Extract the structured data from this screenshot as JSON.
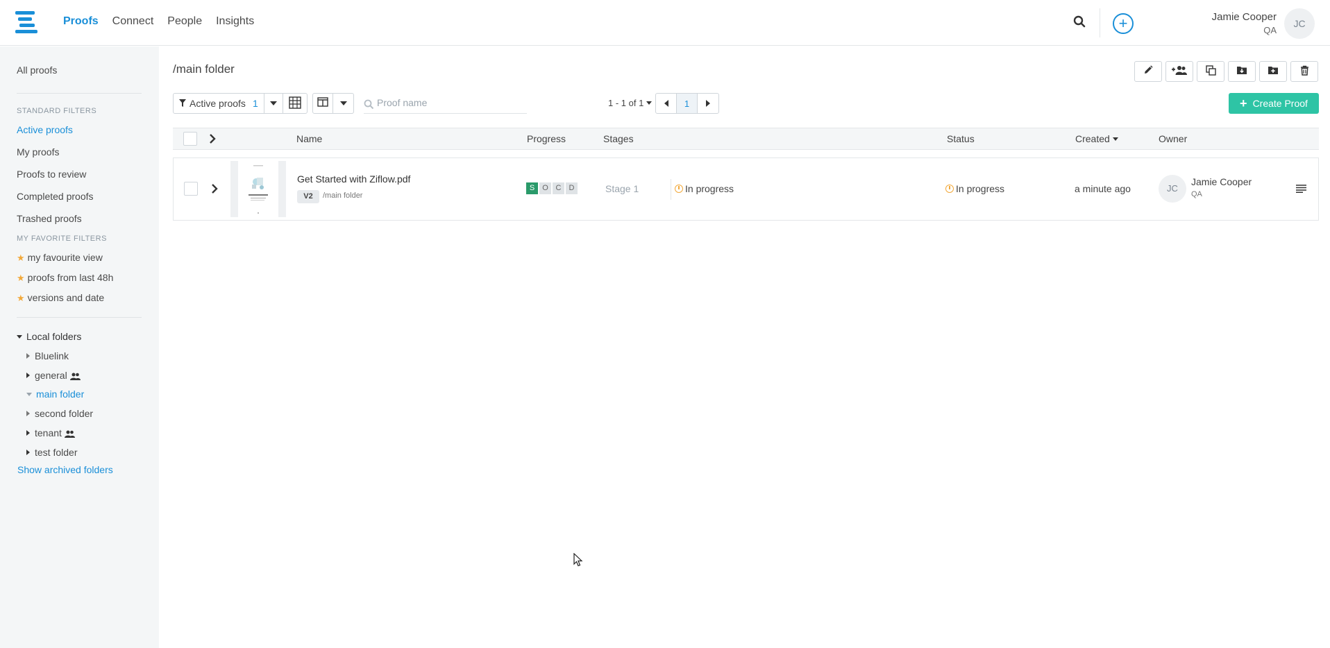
{
  "nav": {
    "items": [
      "Proofs",
      "Connect",
      "People",
      "Insights"
    ]
  },
  "user": {
    "name": "Jamie Cooper",
    "role": "QA",
    "initials": "JC"
  },
  "sidebar": {
    "all_proofs": "All proofs",
    "standard_heading": "STANDARD FILTERS",
    "standard": [
      "Active proofs",
      "My proofs",
      "Proofs to review",
      "Completed proofs",
      "Trashed proofs"
    ],
    "favorite_heading": "MY FAVORITE FILTERS",
    "favorites": [
      "my favourite view",
      "proofs from last 48h",
      "versions and date"
    ],
    "local_folders_label": "Local folders",
    "folders": [
      "Bluelink",
      "general",
      "main folder",
      "second folder",
      "tenant",
      "test folder"
    ],
    "show_archived": "Show archived folders"
  },
  "main": {
    "title": "/main folder",
    "filter_label": "Active proofs",
    "filter_count": "1",
    "search_placeholder": "Proof name",
    "pager_info": "1 - 1 of 1",
    "page": "1",
    "create_label": "Create Proof"
  },
  "table": {
    "headers": {
      "name": "Name",
      "progress": "Progress",
      "stages": "Stages",
      "status": "Status",
      "created": "Created",
      "owner": "Owner"
    },
    "rows": [
      {
        "file_name": "Get Started with Ziflow.pdf",
        "version": "V2",
        "path": "/main folder",
        "progress_steps": [
          "S",
          "O",
          "C",
          "D"
        ],
        "stage": "Stage 1",
        "stage_status": "In progress",
        "status": "In progress",
        "created": "a minute ago",
        "owner_initials": "JC",
        "owner_name": "Jamie Cooper",
        "owner_role": "QA"
      }
    ]
  },
  "colors": {
    "accent": "#1a8fd8",
    "create": "#2ec4a5",
    "progress_done": "#2a9a6a",
    "in_progress": "#f2a93b"
  }
}
